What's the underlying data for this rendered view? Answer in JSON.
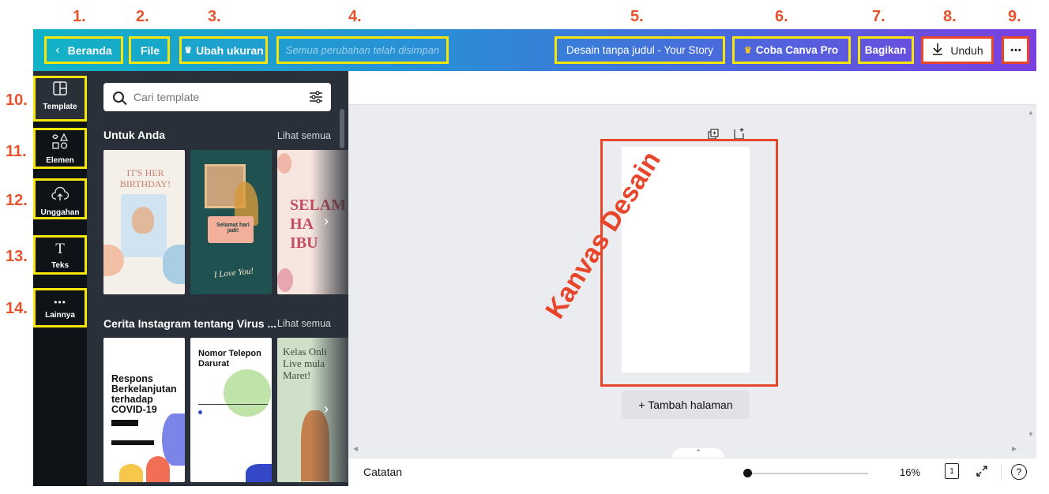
{
  "annotations": [
    "1.",
    "2.",
    "3.",
    "4.",
    "5.",
    "6.",
    "7.",
    "8.",
    "9.",
    "10.",
    "11.",
    "12.",
    "13.",
    "14."
  ],
  "topbar": {
    "home_label": "Beranda",
    "file_label": "File",
    "resize_label": "Ubah ukuran",
    "save_status": "Semua perubahan telah disimpan",
    "doc_title": "Desain tanpa judul - Your Story",
    "pro_label": "Coba Canva Pro",
    "share_label": "Bagikan",
    "download_label": "Unduh",
    "more_label": "•••"
  },
  "rail": {
    "items": [
      {
        "label": "Template",
        "icon": "template-icon"
      },
      {
        "label": "Elemen",
        "icon": "elements-icon"
      },
      {
        "label": "Unggahan",
        "icon": "upload-icon"
      },
      {
        "label": "Teks",
        "icon": "text-icon"
      },
      {
        "label": "Lainnya",
        "icon": "more-icon"
      }
    ]
  },
  "panel": {
    "search_placeholder": "Cari template",
    "section1_title": "Untuk Anda",
    "section1_link": "Lihat semua",
    "section2_title": "Cerita Instagram tentang Virus ...",
    "section2_link": "Lihat semua",
    "t1_title": "IT'S HER BIRTHDAY!",
    "t2_badge": "Selamat hari jadi!",
    "t2_caption": "I Love You!",
    "t3_title": "SELAM HA IBU",
    "t4_title": "Respons Berkelanjutan terhadap COVID-19",
    "t5_title": "Nomor Telepon Darurat",
    "t6_title": "Kelas Onli Live mula Maret!"
  },
  "canvas": {
    "overlay_label": "Kanvas Desain",
    "add_page": "+ Tambah halaman"
  },
  "footer": {
    "notes_label": "Catatan",
    "zoom": "16%",
    "page_count": "1",
    "help": "?"
  },
  "colors": {
    "annotation_number": "#e5532d",
    "highlight_yellow": "#f5e50a",
    "highlight_red": "#e8462a"
  }
}
